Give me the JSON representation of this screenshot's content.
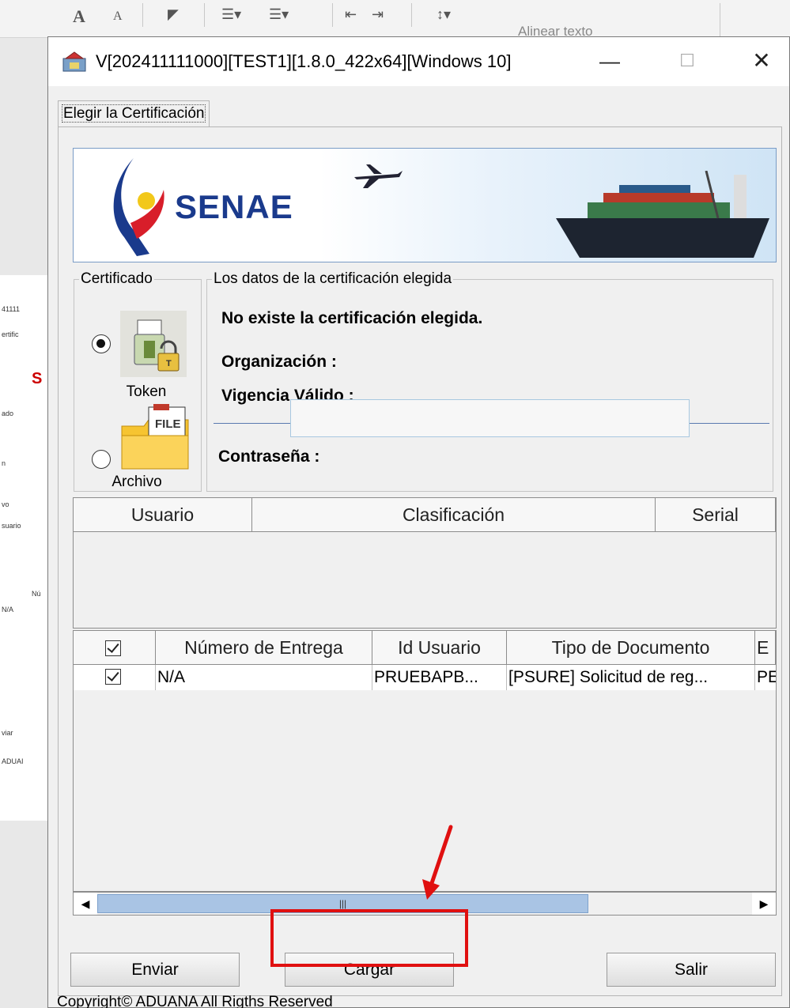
{
  "dialog": {
    "title": "V[202411111000][TEST1][1.8.0_422x64][Windows 10]",
    "minimize_glyph": "—",
    "maximize_glyph": "☐",
    "close_glyph": "✕"
  },
  "tab": {
    "label": "Elegir la Certificación"
  },
  "banner": {
    "brand": "SENAE"
  },
  "certificado": {
    "legend": "Certificado",
    "options": [
      {
        "label": "Token",
        "selected": true,
        "icon": "usb-lock-icon"
      },
      {
        "label": "Archivo",
        "selected": false,
        "icon": "file-folder-icon"
      }
    ],
    "file_icon_text": "FILE"
  },
  "datos": {
    "legend": "Los datos de la certificación elegida",
    "status": "No existe la certificación elegida.",
    "organizacion_label": "Organización :",
    "vigencia_label": "Vigencia Válido :",
    "password_label": "Contraseña :",
    "password_value": ""
  },
  "cert_table": {
    "columns": [
      "Usuario",
      "Clasificación",
      "Serial"
    ],
    "rows": []
  },
  "entregas_table": {
    "columns": [
      "",
      "Número de Entrega",
      "Id Usuario",
      "Tipo de Documento",
      "E"
    ],
    "rows": [
      {
        "checked": true,
        "numero": "N/A",
        "id_usuario": "PRUEBAPB...",
        "tipo": "[PSURE] Solicitud de reg...",
        "e": "PE"
      }
    ]
  },
  "scrollbar": {
    "thumb_glyph": "|||",
    "left_arrow": "◀",
    "right_arrow": "▶"
  },
  "buttons": {
    "enviar": "Enviar",
    "cargar": "Cargar",
    "salir": "Salir"
  },
  "footer": {
    "copyright": "Copyright© ADUANA All Rigths Reserved"
  },
  "background": {
    "ribbon_alinear": "Alinear texto",
    "thumb_texts": [
      "41111",
      "ertific",
      "S",
      "ado",
      "n",
      "vo",
      "suario",
      "Nú",
      "N/A",
      "viar",
      "ADUAI"
    ]
  },
  "colors": {
    "brand_blue": "#1a3a8c",
    "annotation_red": "#e01010",
    "scroll_thumb": "#a9c4e4"
  }
}
